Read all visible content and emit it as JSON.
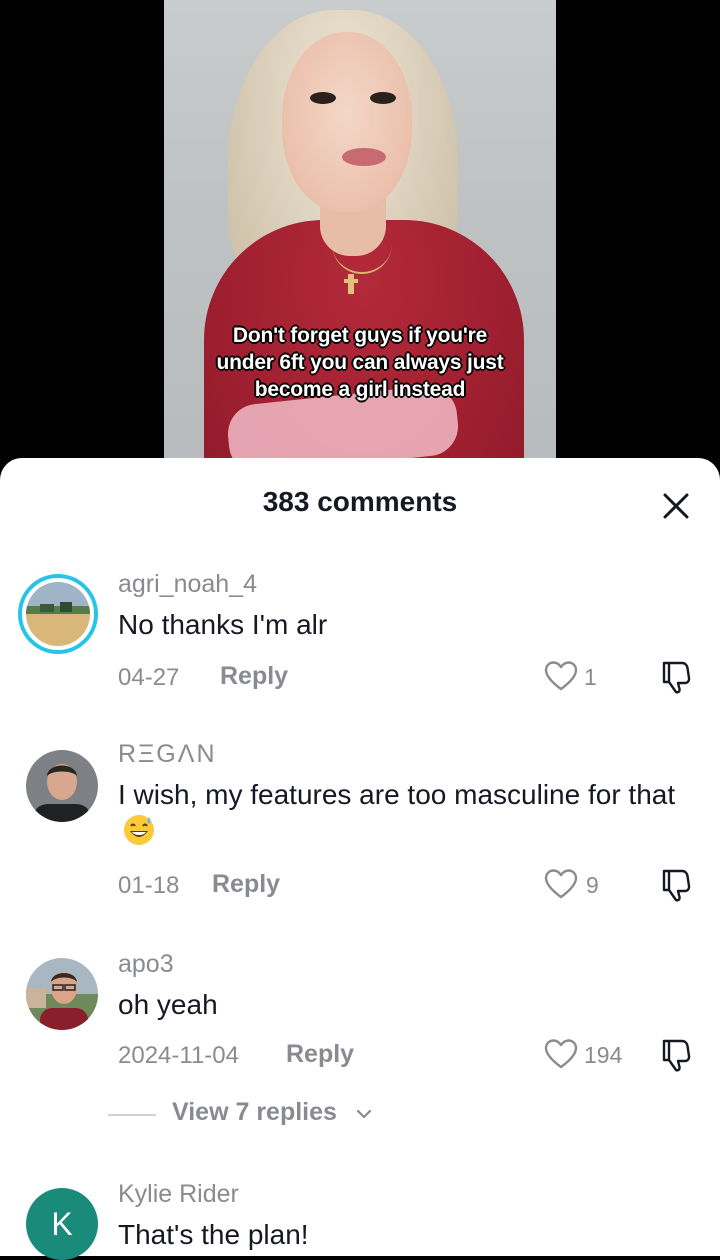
{
  "video": {
    "caption_lines": [
      "Don't forget guys if you're",
      "under 6ft you can always just",
      "become a girl instead"
    ]
  },
  "sheet": {
    "title": "383 comments",
    "close_icon": "close-icon"
  },
  "comments": [
    {
      "username": "agri_noah_4",
      "text": "No thanks I'm alr",
      "date": "04-27",
      "reply_label": "Reply",
      "likes": "1",
      "avatar_ring": "#27c4e8"
    },
    {
      "username": "RΞGΛN",
      "text": "I wish, my features are too masculine for that",
      "emoji": "grinning-sweat-emoji",
      "date": "01-18",
      "reply_label": "Reply",
      "likes": "9"
    },
    {
      "username": "apo3",
      "text": "oh yeah",
      "date": "2024-11-04",
      "reply_label": "Reply",
      "likes": "194",
      "view_replies_label": "View 7 replies"
    },
    {
      "username": "Kylie Rider",
      "text": "That's the plan!",
      "avatar_letter": "K",
      "avatar_color": "#1a8a7a"
    }
  ],
  "colors": {
    "text_primary": "#161823",
    "text_secondary": "#8a8b91"
  }
}
